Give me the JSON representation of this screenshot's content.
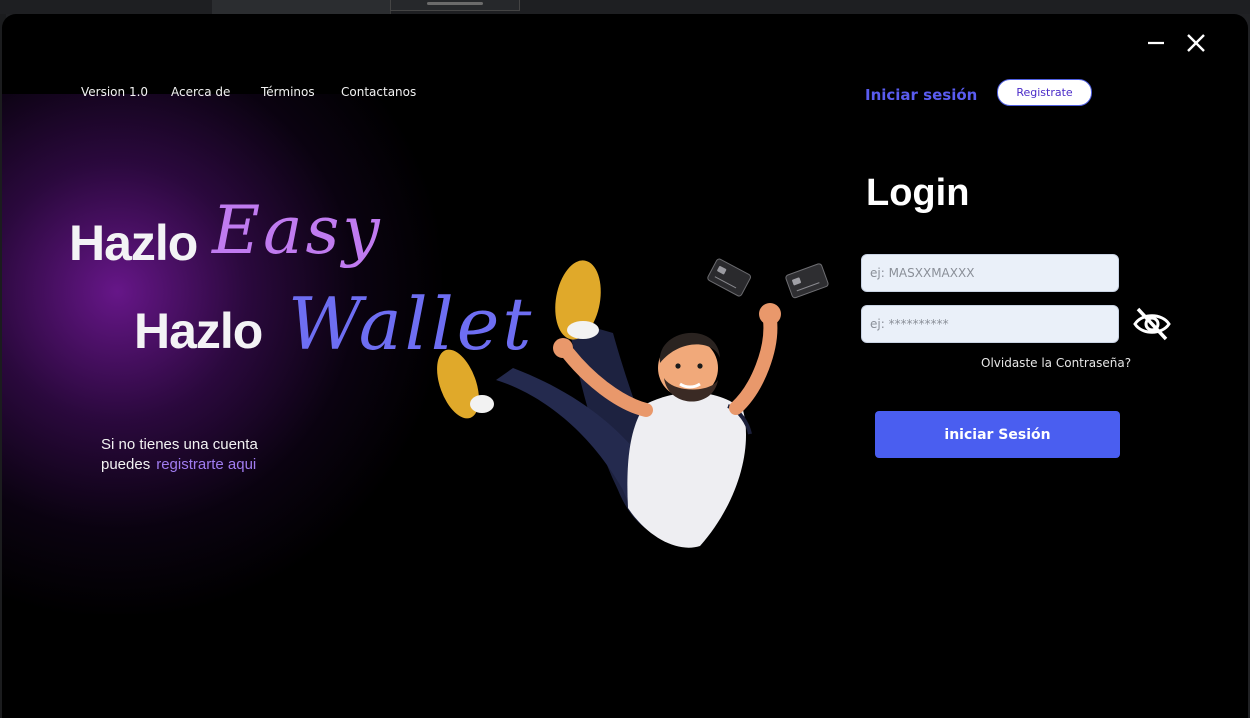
{
  "nav": {
    "version": "Version 1.0",
    "about": "Acerca de",
    "terms": "Términos",
    "contact": "Contactanos"
  },
  "header": {
    "login_link": "Iniciar sesión",
    "register_button": "Registrate"
  },
  "hero": {
    "line1_word": "Hazlo",
    "line1_script": "Easy",
    "line2_word": "Hazlo",
    "line2_script": "Wallet",
    "signup_text_1": "Si no tienes una cuenta",
    "signup_text_2": "puedes",
    "signup_link": "registrarte aqui"
  },
  "login": {
    "title": "Login",
    "username_placeholder": "ej: MASXXMAXXX",
    "password_placeholder": "ej: **********",
    "forgot_password": "Olvidaste la Contraseña?",
    "submit_label": "iniciar Sesión"
  },
  "icons": {
    "minimize": "minimize-icon",
    "close": "close-icon",
    "toggle_password": "eye-slash-icon"
  },
  "colors": {
    "background": "#000000",
    "accent": "#4a5ef0",
    "link": "#5a5cf0",
    "script_easy": "#c07bf0",
    "script_wallet": "#6e6ef2",
    "glow": "#7a1aa0"
  }
}
